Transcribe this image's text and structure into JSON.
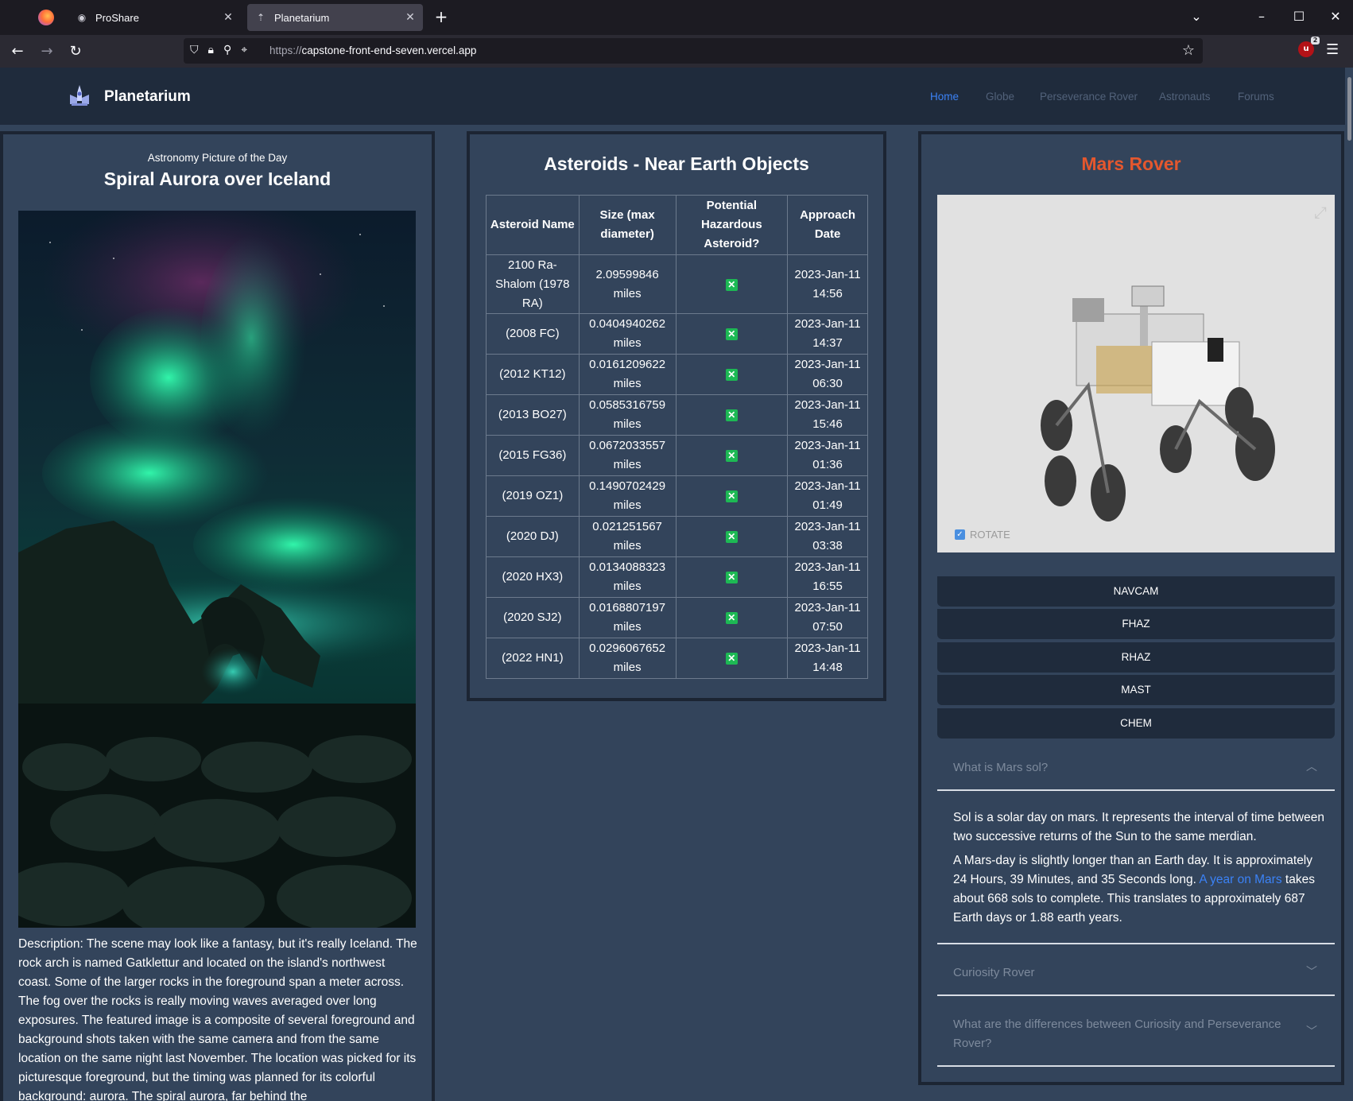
{
  "browser": {
    "tabs": [
      {
        "label": "ProShare",
        "close": "✕"
      },
      {
        "label": "Planetarium",
        "close": "✕"
      }
    ],
    "new_tab": "+",
    "url_protocol": "https://",
    "url_host": "capstone-front-end-seven.vercel.app",
    "extension_count": "2"
  },
  "site": {
    "brand": "Planetarium",
    "nav": [
      "Home",
      "Globe",
      "Perseverance Rover",
      "Astronauts",
      "Forums"
    ]
  },
  "apod": {
    "subtitle": "Astronomy Picture of the Day",
    "title": "Spiral Aurora over Iceland",
    "description": "Description: The scene may look like a fantasy, but it's really Iceland. The rock arch is named Gatklettur and located on the island's northwest coast. Some of the larger rocks in the foreground span a meter across. The fog over the rocks is really moving waves averaged over long exposures. The featured image is a composite of several foreground and background shots taken with the same camera and from the same location on the same night last November. The location was picked for its picturesque foreground, but the timing was planned for its colorful background: aurora. The spiral aurora, far behind the"
  },
  "neo": {
    "title": "Asteroids - Near Earth Objects",
    "headers": [
      "Asteroid Name",
      "Size (max diameter)",
      "Potential Hazardous Asteroid?",
      "Approach Date"
    ],
    "rows": [
      {
        "name": "2100 Ra-Shalom (1978 RA)",
        "size": "2.09599846 miles",
        "date": "2023-Jan-11 14:56"
      },
      {
        "name": "(2008 FC)",
        "size": "0.0404940262 miles",
        "date": "2023-Jan-11 14:37"
      },
      {
        "name": "(2012 KT12)",
        "size": "0.0161209622 miles",
        "date": "2023-Jan-11 06:30"
      },
      {
        "name": "(2013 BO27)",
        "size": "0.0585316759 miles",
        "date": "2023-Jan-11 15:46"
      },
      {
        "name": "(2015 FG36)",
        "size": "0.0672033557 miles",
        "date": "2023-Jan-11 01:36"
      },
      {
        "name": "(2019 OZ1)",
        "size": "0.1490702429 miles",
        "date": "2023-Jan-11 01:49"
      },
      {
        "name": "(2020 DJ)",
        "size": "0.021251567 miles",
        "date": "2023-Jan-11 03:38"
      },
      {
        "name": "(2020 HX3)",
        "size": "0.0134088323 miles",
        "date": "2023-Jan-11 16:55"
      },
      {
        "name": "(2020 SJ2)",
        "size": "0.0168807197 miles",
        "date": "2023-Jan-11 07:50"
      },
      {
        "name": "(2022 HN1)",
        "size": "0.0296067652 miles",
        "date": "2023-Jan-11 14:48"
      }
    ],
    "hazard_icon": "✕"
  },
  "mars": {
    "title": "Mars Rover",
    "rotate_label": "ROTATE",
    "cameras": [
      "NAVCAM",
      "FHAZ",
      "RHAZ",
      "MAST",
      "CHEM"
    ],
    "faq": [
      {
        "q": "What is Mars sol?"
      },
      {
        "q": "Curiosity Rover"
      },
      {
        "q": "What are the differences between Curiosity and Perseverance Rover?"
      }
    ],
    "sol_p1": "Sol is a solar day on mars. It represents the interval of time between two successive returns of the Sun to the same merdian.",
    "sol_p2_a": "A Mars-day is slightly longer than an Earth day. It is approximately 24 Hours, 39 Minutes, and 35 Seconds long.",
    "sol_p2_link": "A year on Mars",
    "sol_p2_b": "takes about 668 sols to complete. This translates to approximately 687 Earth days or 1.88 earth years."
  },
  "colors": {
    "accent": "#3b82f6",
    "mars_title": "#e4572e",
    "panel_bg": "#33445b",
    "header_bg": "#1f2b3c",
    "hazard_no": "#1db954"
  }
}
